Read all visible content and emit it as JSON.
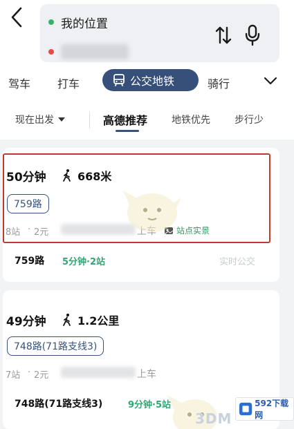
{
  "header": {
    "origin": "我的位置",
    "back_icon": "back-arrow-icon",
    "swap_icon": "swap-arrows-icon",
    "voice_icon": "microphone-icon"
  },
  "modes": {
    "items": [
      "驾车",
      "打车",
      "公交地铁",
      "骑行"
    ],
    "active": "公交地铁",
    "active_color": "#36507a"
  },
  "filters": {
    "depart": "现在出发",
    "selected": "高德推荐",
    "options": [
      "地铁优先",
      "步行少"
    ]
  },
  "routes": [
    {
      "duration": "50分钟",
      "walk": "668米",
      "badge": "759路",
      "stops": "8站",
      "fare": "2元",
      "board": "上车",
      "photo": "站点实景",
      "segment_line": "759路",
      "segment_status": "5分钟·2站",
      "realtime": "实时公交"
    },
    {
      "duration": "49分钟",
      "walk": "1.2公里",
      "badge": "748路(71路支线3)",
      "stops": "7站",
      "fare": "2元",
      "board": "上车",
      "segment_line": "748路(71路支线3)",
      "segment_status": "9分钟·5站"
    }
  ],
  "watermark": {
    "brand": "3DM",
    "site": "592下载网"
  },
  "colors": {
    "accent": "#36507a",
    "highlight_border": "#c0392b",
    "status_green": "#2fa774"
  }
}
